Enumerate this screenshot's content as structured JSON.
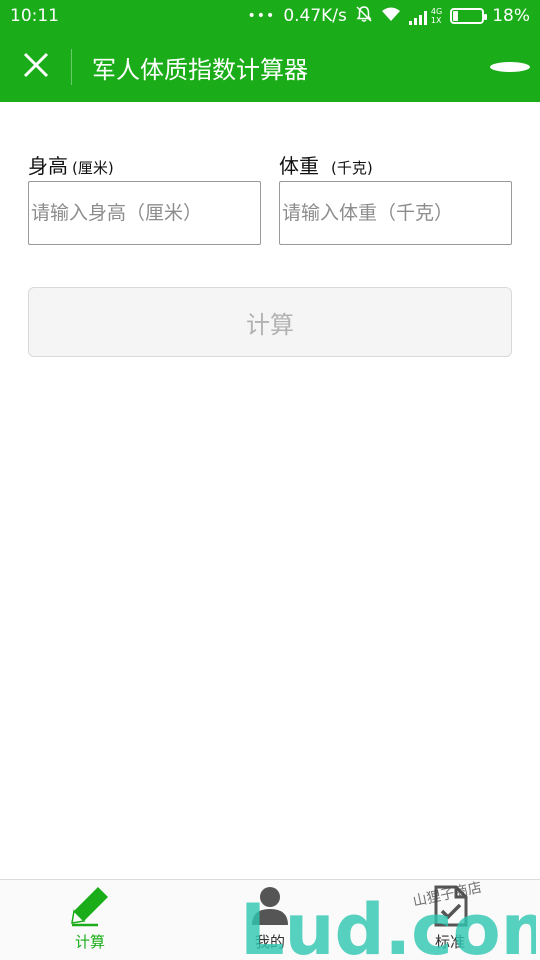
{
  "status_bar": {
    "time": "10:11",
    "dots": "•••",
    "speed": "0.47K/s",
    "network_top": "4G",
    "network_bottom": "1X",
    "battery": "18%",
    "battery_level": 0.18
  },
  "nav": {
    "title": "军人体质指数计算器",
    "close_icon": "close-icon",
    "more_icon": "more-icon"
  },
  "form": {
    "height": {
      "label": "身高",
      "unit": "(厘米)",
      "placeholder": "请输入身高（厘米）"
    },
    "weight": {
      "label": "体重",
      "unit": "(千克)",
      "placeholder": "请输入体重（千克）"
    },
    "calc_button": "计算"
  },
  "tabs": [
    {
      "label": "计算",
      "icon": "pencil-icon",
      "active": true
    },
    {
      "label": "我的",
      "icon": "user-icon",
      "active": false
    },
    {
      "label": "标准",
      "icon": "document-check-icon",
      "active": false
    }
  ],
  "watermark": {
    "text": "Lud.com",
    "handwriting": "山狸子商店"
  },
  "colors": {
    "brand_green": "#1aad19",
    "button_text_disabled": "#b2b2b2",
    "input_border": "#999999"
  }
}
